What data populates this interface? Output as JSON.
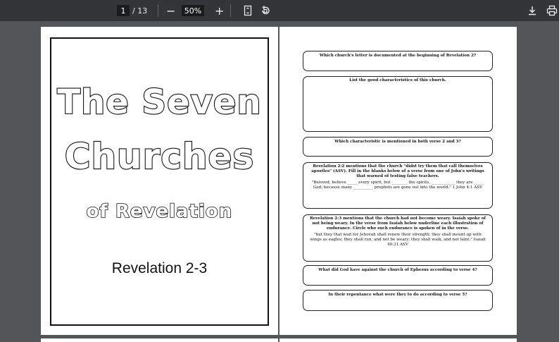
{
  "toolbar": {
    "current_page": "1",
    "total_pages": "/ 13",
    "zoom_minus": "−",
    "zoom_value": "50%",
    "zoom_plus": "+",
    "icons": [
      "fit-page-icon",
      "rotate-icon",
      "download-icon",
      "print-icon"
    ]
  },
  "cover": {
    "title_line1": "The Seven",
    "title_line2": "Churches",
    "title_line3": "of Revelation",
    "subtitle": "Revelation 2-3"
  },
  "worksheet": {
    "q1": "Which church's letter is documented at the beginning of Revelation 2?",
    "q2": "List the good characteristics of this church.",
    "q3": "Which characteristic is mentioned in both verse 2 and 3?",
    "q4_title": "Revelation 2:2 mentions that the church \"didst try them that call themselves apostles\" (ASV). Fill in the blanks below of a verse from one of John's writings that warned of testing false teachers.",
    "q4_body": "\"Beloved, believe _____ every spirit, but ________ the spirits, ____________ they are _____ God; because many __________ prophets are gone out into the world.\" 1 John 4:1 ASV",
    "q5_title": "Revelation 2:3 mentions that the church had not become weary. Isaiah spoke of not being weary. In the verse from Isaiah below underline each illustration of endurance. Circle who such endurance is spoken of in the verse.",
    "q5_body": "\"but they that wait for Jehovah shall renew their strength; they shall mount up with wings as eagles; they shall run, and not be weary; they shall walk, and not faint.\" Isaiah 40:31 ASV",
    "q6": "What did God have against the church of Ephesus according to verse 4?",
    "q7": "In their repentance what were they to do according to verse 5?"
  }
}
